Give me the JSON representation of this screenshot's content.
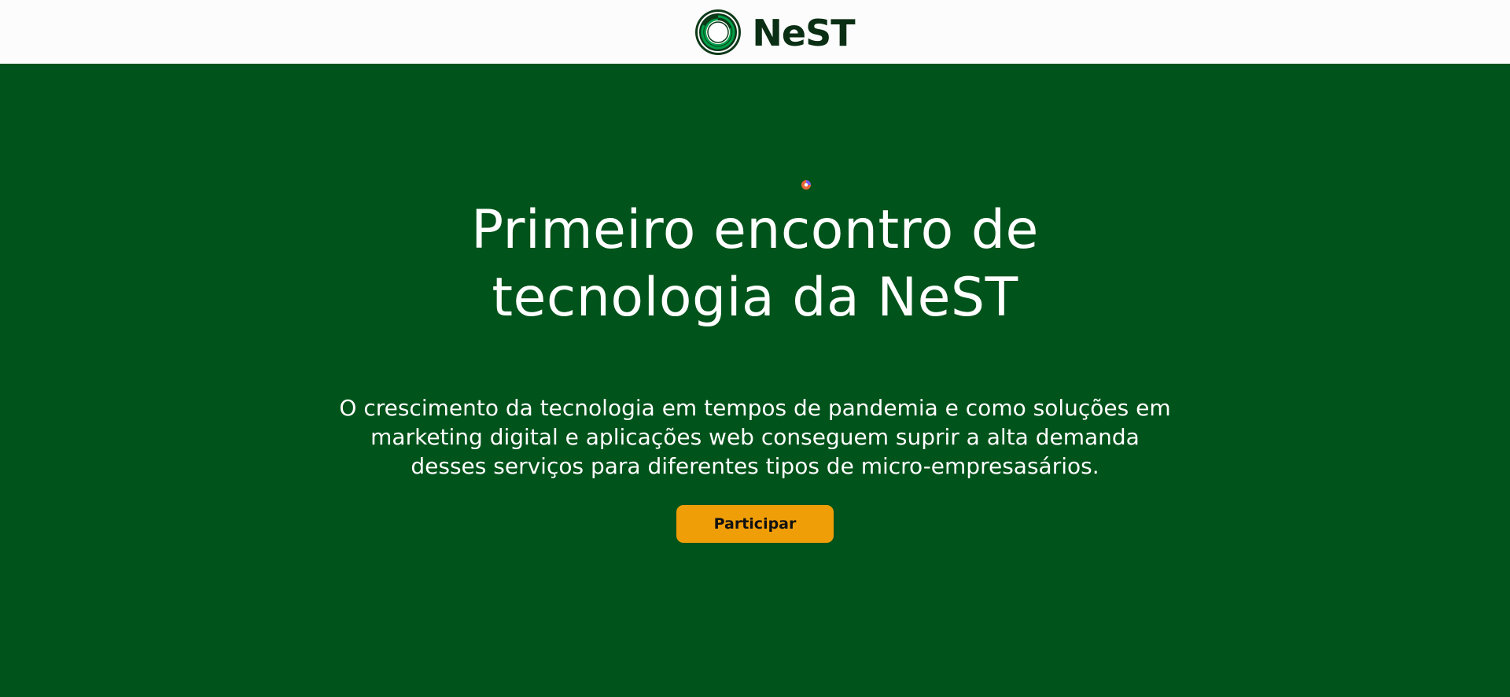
{
  "header": {
    "logo_text": "NeST",
    "logo_icon": "concentric-rings-logo-icon"
  },
  "hero": {
    "title_line1": "Primeiro encontro de",
    "title_line2": "tecnologia da NeST",
    "subtitle_line1": "O crescimento da tecnologia em tempos de pandemia e como soluções em",
    "subtitle_line2": "marketing digital e aplicações web conseguem suprir a alta demanda",
    "subtitle_line3": "desses serviços para diferentes tipos de micro-empresasários.",
    "cta_label": "Participar"
  },
  "colors": {
    "brand_green": "#00531a",
    "header_bg": "#fcfcfc",
    "logo_dark": "#0b2f14",
    "cta_orange": "#f09e08"
  },
  "icons": {
    "cursor": "busy-cursor-icon"
  }
}
